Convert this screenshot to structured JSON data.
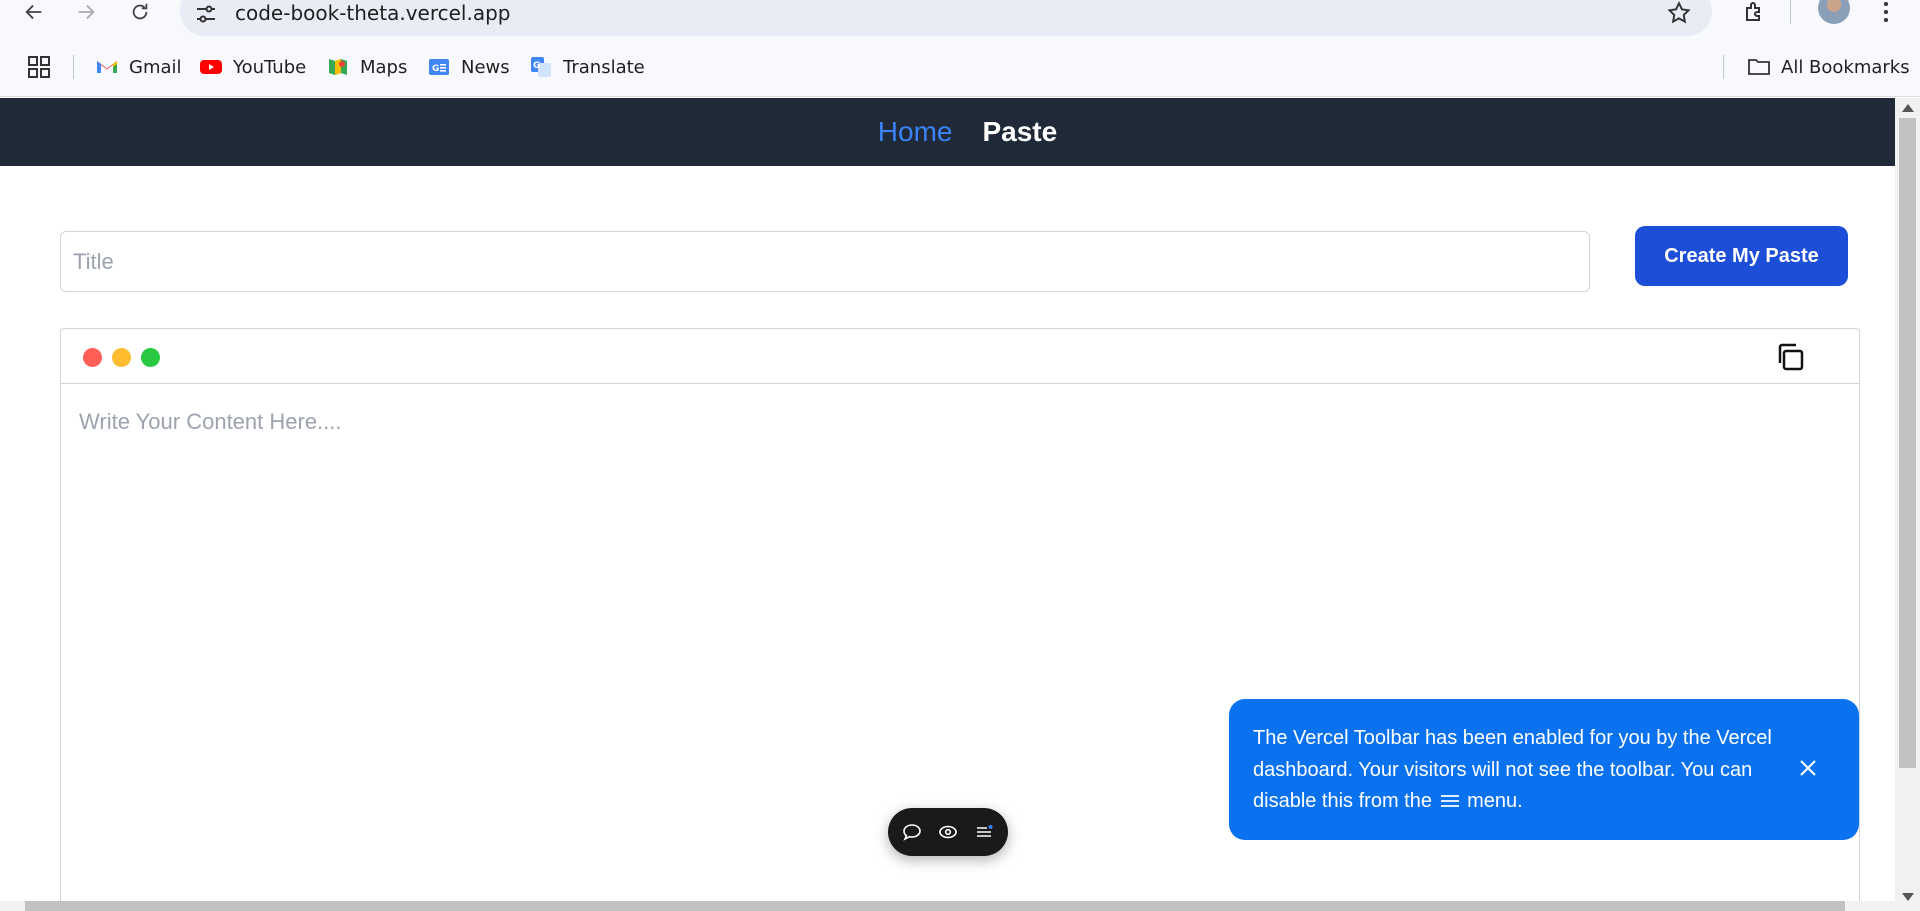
{
  "browser": {
    "url": "code-book-theta.vercel.app",
    "bookmarks": [
      {
        "label": "Gmail",
        "icon": "gmail-icon"
      },
      {
        "label": "YouTube",
        "icon": "youtube-icon"
      },
      {
        "label": "Maps",
        "icon": "maps-icon"
      },
      {
        "label": "News",
        "icon": "news-icon"
      },
      {
        "label": "Translate",
        "icon": "translate-icon"
      }
    ],
    "all_bookmarks_label": "All Bookmarks"
  },
  "nav": {
    "home_label": "Home",
    "paste_label": "Paste",
    "home_color": "#3b82f6",
    "bg_color": "#1f2937"
  },
  "form": {
    "title_placeholder": "Title",
    "title_value": "",
    "create_button_label": "Create My Paste",
    "content_placeholder": "Write Your Content Here....",
    "content_value": ""
  },
  "editor": {
    "window_dots": [
      "#ff5f57",
      "#febc2e",
      "#28c840"
    ],
    "copy_icon": "copy-icon"
  },
  "vercel_toolbar": {
    "icons": [
      "comment-icon",
      "eye-icon",
      "menu-icon"
    ]
  },
  "toast": {
    "text_before": "The Vercel Toolbar has been enabled for you by the Vercel dashboard. Your visitors will not see the toolbar. You can disable this from the",
    "text_after": "menu.",
    "bg_color": "#0a72ef"
  }
}
